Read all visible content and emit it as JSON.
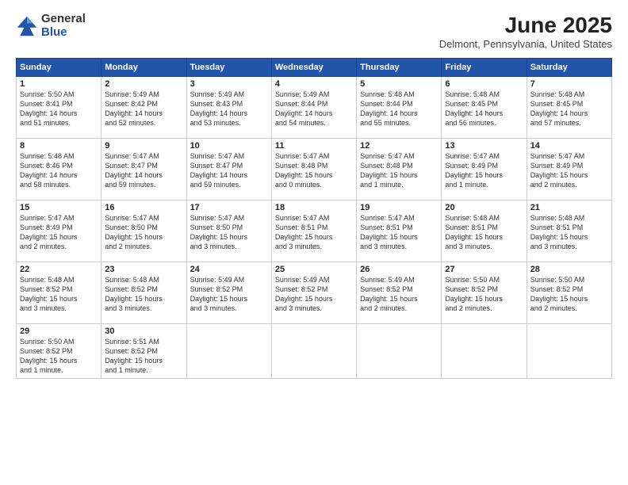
{
  "header": {
    "logo_general": "General",
    "logo_blue": "Blue",
    "month": "June 2025",
    "location": "Delmont, Pennsylvania, United States"
  },
  "days_of_week": [
    "Sunday",
    "Monday",
    "Tuesday",
    "Wednesday",
    "Thursday",
    "Friday",
    "Saturday"
  ],
  "weeks": [
    [
      {
        "day": "1",
        "info": "Sunrise: 5:50 AM\nSunset: 8:41 PM\nDaylight: 14 hours\nand 51 minutes."
      },
      {
        "day": "2",
        "info": "Sunrise: 5:49 AM\nSunset: 8:42 PM\nDaylight: 14 hours\nand 52 minutes."
      },
      {
        "day": "3",
        "info": "Sunrise: 5:49 AM\nSunset: 8:43 PM\nDaylight: 14 hours\nand 53 minutes."
      },
      {
        "day": "4",
        "info": "Sunrise: 5:49 AM\nSunset: 8:44 PM\nDaylight: 14 hours\nand 54 minutes."
      },
      {
        "day": "5",
        "info": "Sunrise: 5:48 AM\nSunset: 8:44 PM\nDaylight: 14 hours\nand 55 minutes."
      },
      {
        "day": "6",
        "info": "Sunrise: 5:48 AM\nSunset: 8:45 PM\nDaylight: 14 hours\nand 56 minutes."
      },
      {
        "day": "7",
        "info": "Sunrise: 5:48 AM\nSunset: 8:45 PM\nDaylight: 14 hours\nand 57 minutes."
      }
    ],
    [
      {
        "day": "8",
        "info": "Sunrise: 5:48 AM\nSunset: 8:46 PM\nDaylight: 14 hours\nand 58 minutes."
      },
      {
        "day": "9",
        "info": "Sunrise: 5:47 AM\nSunset: 8:47 PM\nDaylight: 14 hours\nand 59 minutes."
      },
      {
        "day": "10",
        "info": "Sunrise: 5:47 AM\nSunset: 8:47 PM\nDaylight: 14 hours\nand 59 minutes."
      },
      {
        "day": "11",
        "info": "Sunrise: 5:47 AM\nSunset: 8:48 PM\nDaylight: 15 hours\nand 0 minutes."
      },
      {
        "day": "12",
        "info": "Sunrise: 5:47 AM\nSunset: 8:48 PM\nDaylight: 15 hours\nand 1 minute."
      },
      {
        "day": "13",
        "info": "Sunrise: 5:47 AM\nSunset: 8:49 PM\nDaylight: 15 hours\nand 1 minute."
      },
      {
        "day": "14",
        "info": "Sunrise: 5:47 AM\nSunset: 8:49 PM\nDaylight: 15 hours\nand 2 minutes."
      }
    ],
    [
      {
        "day": "15",
        "info": "Sunrise: 5:47 AM\nSunset: 8:49 PM\nDaylight: 15 hours\nand 2 minutes."
      },
      {
        "day": "16",
        "info": "Sunrise: 5:47 AM\nSunset: 8:50 PM\nDaylight: 15 hours\nand 2 minutes."
      },
      {
        "day": "17",
        "info": "Sunrise: 5:47 AM\nSunset: 8:50 PM\nDaylight: 15 hours\nand 3 minutes."
      },
      {
        "day": "18",
        "info": "Sunrise: 5:47 AM\nSunset: 8:51 PM\nDaylight: 15 hours\nand 3 minutes."
      },
      {
        "day": "19",
        "info": "Sunrise: 5:47 AM\nSunset: 8:51 PM\nDaylight: 15 hours\nand 3 minutes."
      },
      {
        "day": "20",
        "info": "Sunrise: 5:48 AM\nSunset: 8:51 PM\nDaylight: 15 hours\nand 3 minutes."
      },
      {
        "day": "21",
        "info": "Sunrise: 5:48 AM\nSunset: 8:51 PM\nDaylight: 15 hours\nand 3 minutes."
      }
    ],
    [
      {
        "day": "22",
        "info": "Sunrise: 5:48 AM\nSunset: 8:52 PM\nDaylight: 15 hours\nand 3 minutes."
      },
      {
        "day": "23",
        "info": "Sunrise: 5:48 AM\nSunset: 8:52 PM\nDaylight: 15 hours\nand 3 minutes."
      },
      {
        "day": "24",
        "info": "Sunrise: 5:49 AM\nSunset: 8:52 PM\nDaylight: 15 hours\nand 3 minutes."
      },
      {
        "day": "25",
        "info": "Sunrise: 5:49 AM\nSunset: 8:52 PM\nDaylight: 15 hours\nand 3 minutes."
      },
      {
        "day": "26",
        "info": "Sunrise: 5:49 AM\nSunset: 8:52 PM\nDaylight: 15 hours\nand 2 minutes."
      },
      {
        "day": "27",
        "info": "Sunrise: 5:50 AM\nSunset: 8:52 PM\nDaylight: 15 hours\nand 2 minutes."
      },
      {
        "day": "28",
        "info": "Sunrise: 5:50 AM\nSunset: 8:52 PM\nDaylight: 15 hours\nand 2 minutes."
      }
    ],
    [
      {
        "day": "29",
        "info": "Sunrise: 5:50 AM\nSunset: 8:52 PM\nDaylight: 15 hours\nand 1 minute."
      },
      {
        "day": "30",
        "info": "Sunrise: 5:51 AM\nSunset: 8:52 PM\nDaylight: 15 hours\nand 1 minute."
      },
      {
        "day": "",
        "info": ""
      },
      {
        "day": "",
        "info": ""
      },
      {
        "day": "",
        "info": ""
      },
      {
        "day": "",
        "info": ""
      },
      {
        "day": "",
        "info": ""
      }
    ]
  ]
}
